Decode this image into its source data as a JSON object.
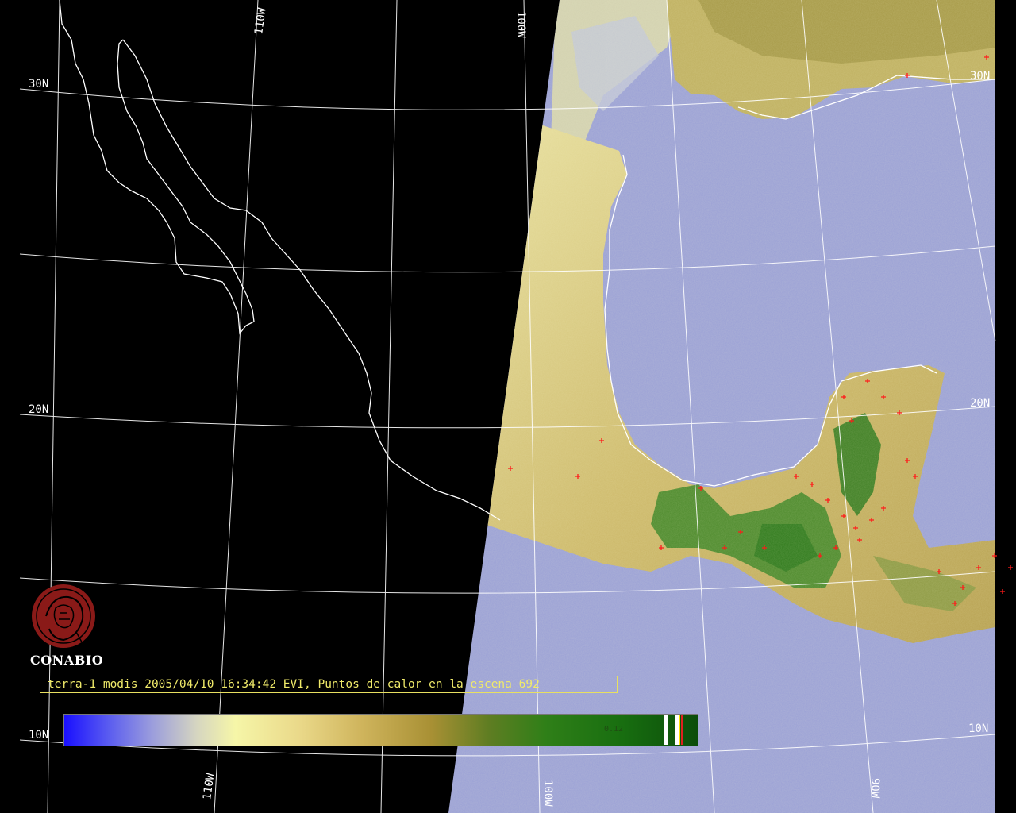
{
  "map": {
    "title_caption": "terra-1 modis 2005/04/10 16:34:42 EVI, Puntos de calor en la escena 692",
    "organization": "CONABIO",
    "grid_labels": {
      "lat_30": "30N",
      "lat_20": "20N",
      "lat_10": "10N",
      "lon_110": "110W",
      "lon_100": "100W",
      "lon_90": "90W"
    },
    "colorbar": {
      "value_label": "0.12",
      "colors": [
        "#1a10ff",
        "#9c9edc",
        "#f6f6a8",
        "#a89034",
        "#2f7f18",
        "#0b4d0a"
      ]
    },
    "colors": {
      "ocean": "#9aa0d6",
      "land_dry": "#d8ca7a",
      "land_veg": "#3a8a28",
      "coastline": "#ffffff",
      "hotspot": "#ff1a1a",
      "caption": "#f0ea6a"
    }
  }
}
